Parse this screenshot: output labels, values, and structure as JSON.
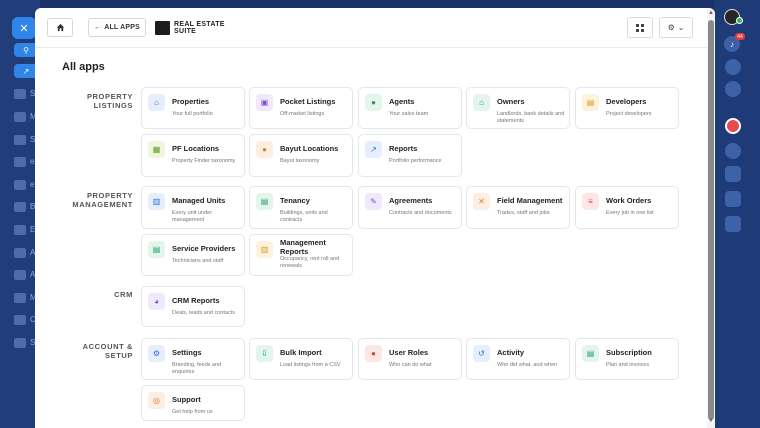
{
  "background": {
    "nav_letters": [
      "S",
      "M",
      "S",
      "e",
      "e",
      "B",
      "E",
      "A",
      "A",
      "M",
      "C",
      "S"
    ]
  },
  "header": {
    "back_label": "ALL APPS",
    "brand_name": "REAL ESTATE SUITE"
  },
  "page_title": "All apps",
  "sections": [
    {
      "label": "PROPERTY LISTINGS",
      "tiles": [
        {
          "title": "Properties",
          "desc": "Your full portfolio",
          "icon": "home-icon",
          "glyph": "⌂",
          "color": "blue"
        },
        {
          "title": "Pocket Listings",
          "desc": "Off-market listings",
          "icon": "lock-icon",
          "glyph": "▣",
          "color": "purple"
        },
        {
          "title": "Agents",
          "desc": "Your sales team",
          "icon": "users-icon",
          "glyph": "●",
          "color": "green"
        },
        {
          "title": "Owners",
          "desc": "Landlords, bank details and statements",
          "icon": "owner-home-icon",
          "glyph": "⌂",
          "color": "green"
        },
        {
          "title": "Developers",
          "desc": "Project developers",
          "icon": "briefcase-icon",
          "glyph": "▤",
          "color": "yellow"
        },
        {
          "title": "PF Locations",
          "desc": "Property Finder taxonomy",
          "icon": "map-icon",
          "glyph": "▦",
          "color": "lime"
        },
        {
          "title": "Bayut Locations",
          "desc": "Bayut taxonomy",
          "icon": "pin-icon",
          "glyph": "●",
          "color": "orange"
        },
        {
          "title": "Reports",
          "desc": "Portfolio performance",
          "icon": "chart-line-icon",
          "glyph": "↗",
          "color": "blue"
        }
      ]
    },
    {
      "label": "PROPERTY MANAGEMENT",
      "tiles": [
        {
          "title": "Managed Units",
          "desc": "Every unit under management",
          "icon": "building-icon",
          "glyph": "▥",
          "color": "blue"
        },
        {
          "title": "Tenancy",
          "desc": "Buildings, units and contracts",
          "icon": "document-icon",
          "glyph": "▤",
          "color": "green"
        },
        {
          "title": "Agreements",
          "desc": "Contracts and documents",
          "icon": "contract-icon",
          "glyph": "✎",
          "color": "purple"
        },
        {
          "title": "Field Management",
          "desc": "Trades, staff and jobs",
          "icon": "tools-icon",
          "glyph": "✕",
          "color": "orange"
        },
        {
          "title": "Work Orders",
          "desc": "Every job in one list",
          "icon": "list-icon",
          "glyph": "≡",
          "color": "red"
        },
        {
          "title": "Service Providers",
          "desc": "Technicians and staff",
          "icon": "id-card-icon",
          "glyph": "▤",
          "color": "green"
        },
        {
          "title": "Management Reports",
          "desc": "Occupancy, rent roll and renewals",
          "icon": "bar-chart-icon",
          "glyph": "▥",
          "color": "yellow"
        }
      ]
    },
    {
      "label": "CRM",
      "tiles": [
        {
          "title": "CRM Reports",
          "desc": "Deals, leads and contacts",
          "icon": "pie-chart-icon",
          "glyph": "◕",
          "color": "purple"
        }
      ]
    },
    {
      "label": "ACCOUNT & SETUP",
      "tiles": [
        {
          "title": "Settings",
          "desc": "Branding, feeds and enquiries",
          "icon": "gear-icon",
          "glyph": "⚙",
          "color": "blue"
        },
        {
          "title": "Bulk Import",
          "desc": "Load listings from a CSV",
          "icon": "import-icon",
          "glyph": "⇩",
          "color": "green"
        },
        {
          "title": "User Roles",
          "desc": "Who can do what",
          "icon": "user-roles-icon",
          "glyph": "●",
          "color": "red"
        },
        {
          "title": "Activity",
          "desc": "Who did what, and when",
          "icon": "history-icon",
          "glyph": "↺",
          "color": "blue"
        },
        {
          "title": "Subscription",
          "desc": "Plan and invoices",
          "icon": "invoice-icon",
          "glyph": "▤",
          "color": "green"
        },
        {
          "title": "Support",
          "desc": "Get help from us",
          "icon": "support-icon",
          "glyph": "◎",
          "color": "orange"
        }
      ]
    }
  ],
  "notifications": {
    "count": "44"
  }
}
